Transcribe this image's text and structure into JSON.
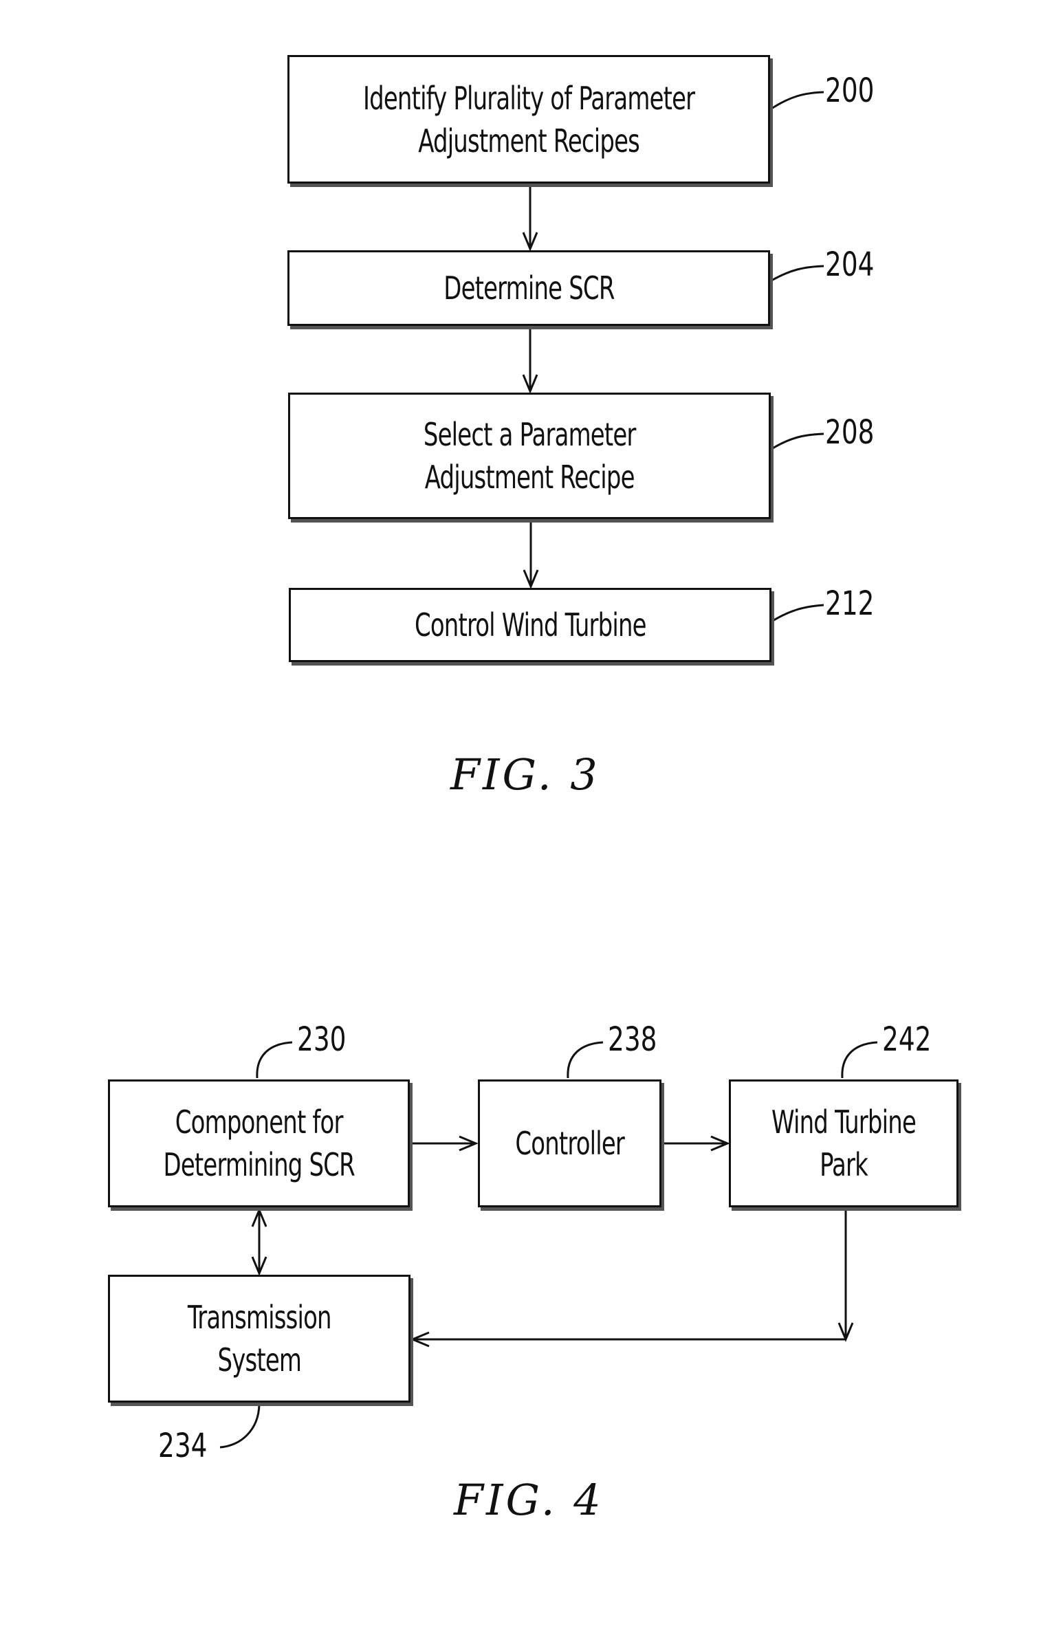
{
  "fig3": {
    "caption": "FIG. 3",
    "steps": [
      {
        "ref": "200",
        "label": "Identify Plurality of Parameter\nAdjustment Recipes"
      },
      {
        "ref": "204",
        "label": "Determine SCR"
      },
      {
        "ref": "208",
        "label": "Select a Parameter\nAdjustment Recipe"
      },
      {
        "ref": "212",
        "label": "Control Wind Turbine"
      }
    ]
  },
  "fig4": {
    "caption": "FIG. 4",
    "blocks": {
      "component": {
        "ref": "230",
        "label": "Component for\nDetermining SCR"
      },
      "transmission": {
        "ref": "234",
        "label": "Transmission\nSystem"
      },
      "controller": {
        "ref": "238",
        "label": "Controller"
      },
      "park": {
        "ref": "242",
        "label": "Wind Turbine\nPark"
      }
    }
  }
}
